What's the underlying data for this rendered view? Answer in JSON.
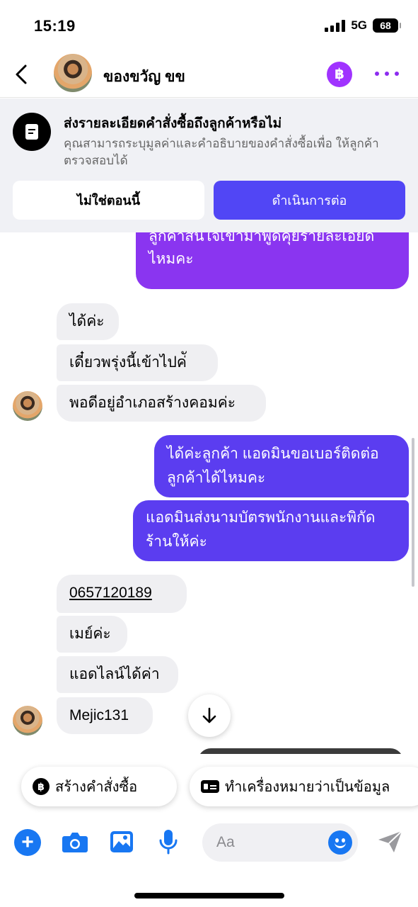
{
  "status_bar": {
    "time": "15:19",
    "network": "5G",
    "battery": "68"
  },
  "header": {
    "contact_name": "ของขวัญ ขข",
    "payment_symbol": "฿"
  },
  "banner": {
    "title": "ส่งรายละเอียดคำสั่งซื้อถึงลูกค้าหรือไม่",
    "description": "คุณสามารถระบุมูลค่าและคำอธิบายของคำสั่งซื้อเพื่อ ให้ลูกค้าตรวจสอบได้",
    "secondary_button": "ไม่ใช่ตอนนี้",
    "primary_button": "ดำเนินการต่อ"
  },
  "messages": [
    {
      "direction": "outgoing",
      "text": "ลูกค้าสนใจเข้ามาพูดคุยรายละเอียด\nไหมคะ"
    },
    {
      "direction": "incoming",
      "text": "ได้ค่ะ"
    },
    {
      "direction": "incoming",
      "text": "เดี๋ยวพรุ่งนี้เข้าไปค่ั"
    },
    {
      "direction": "incoming",
      "text": "พอดีอยู่อำเภอสร้างคอมค่ะ"
    },
    {
      "direction": "outgoing",
      "text": "ได้ค่ะลูกค้า แอดมินขอเบอร์ติดต่อ\nลูกค้าได้ไหมคะ"
    },
    {
      "direction": "outgoing",
      "text": "แอดมินส่งนามบัตรพนักงานและพิกัด\nร้านให้ค่ะ"
    },
    {
      "direction": "incoming",
      "text": "0657120189"
    },
    {
      "direction": "incoming",
      "text": "เมย์ค่ะ"
    },
    {
      "direction": "incoming",
      "text": "แอดไลน์ได้ค่า"
    },
    {
      "direction": "incoming",
      "text": "Mejic131"
    }
  ],
  "quick_actions": [
    {
      "label": "สร้างคำสั่งซื้อ",
      "icon": "baht-icon"
    },
    {
      "label": "ทำเครื่องหมายว่าเป็นข้อมูล",
      "icon": "id-card-icon"
    }
  ],
  "composer": {
    "placeholder": "Aa"
  },
  "colors": {
    "outgoing_top": "#8a35f0",
    "outgoing": "#5b3df0",
    "accent": "#1877f2",
    "primary_button": "#5146f5"
  }
}
